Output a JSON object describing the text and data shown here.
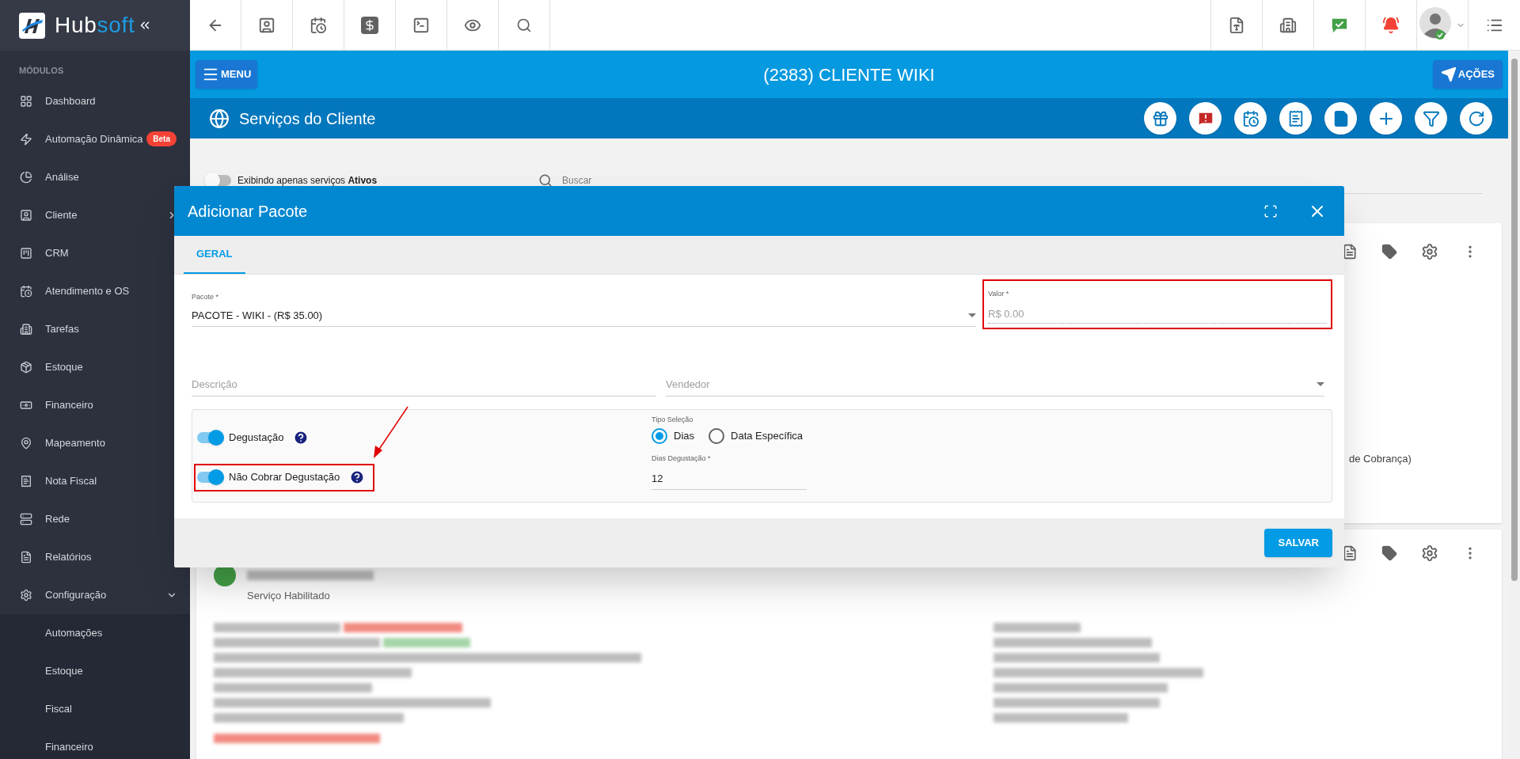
{
  "sidebar": {
    "brand_left": "Hub",
    "brand_right": "soft",
    "section": "MÓDULOS",
    "items": [
      {
        "label": "Dashboard",
        "kind": "link"
      },
      {
        "label": "Automação Dinâmica",
        "kind": "link",
        "badge": "Beta"
      },
      {
        "label": "Análise",
        "kind": "link"
      },
      {
        "label": "Cliente",
        "kind": "group",
        "expanded": false
      },
      {
        "label": "CRM",
        "kind": "link"
      },
      {
        "label": "Atendimento e OS",
        "kind": "link"
      },
      {
        "label": "Tarefas",
        "kind": "link"
      },
      {
        "label": "Estoque",
        "kind": "link"
      },
      {
        "label": "Financeiro",
        "kind": "link"
      },
      {
        "label": "Mapeamento",
        "kind": "link"
      },
      {
        "label": "Nota Fiscal",
        "kind": "link"
      },
      {
        "label": "Rede",
        "kind": "link"
      },
      {
        "label": "Relatórios",
        "kind": "link"
      },
      {
        "label": "Configuração",
        "kind": "group",
        "expanded": true,
        "children": [
          {
            "label": "Automações"
          },
          {
            "label": "Estoque"
          },
          {
            "label": "Fiscal"
          },
          {
            "label": "Financeiro"
          }
        ]
      }
    ]
  },
  "header": {
    "menu_button": "MENU",
    "title": "(2383) CLIENTE WIKI",
    "actions_button": "AÇÕES"
  },
  "page": {
    "title": "Serviços do Cliente",
    "filter_toggle": {
      "label": "Exibindo apenas serviços **Ativos**",
      "on": false
    },
    "search": {
      "placeholder": "Buscar"
    }
  },
  "cards": [
    {
      "tail_text": "de Cobrança)"
    },
    {
      "status": "Serviço Habilitado"
    }
  ],
  "modal": {
    "title": "Adicionar Pacote",
    "tabs": [
      {
        "label": "GERAL",
        "selected": true
      }
    ],
    "pacote": {
      "label": "Pacote *",
      "value": "PACOTE - WIKI - (R$ 35.00)"
    },
    "valor": {
      "label": "Valor *",
      "placeholder": "R$ 0.00",
      "highlighted": true
    },
    "descricao": {
      "placeholder": "Descrição"
    },
    "vendedor": {
      "placeholder": "Vendedor"
    },
    "toggles": [
      {
        "label": "Degustação",
        "on": true,
        "highlighted": false
      },
      {
        "label": "Não Cobrar Degustação",
        "on": true,
        "highlighted": true
      }
    ],
    "tipo": {
      "label": "Tipo Seleção",
      "options": [
        {
          "label": "Dias",
          "selected": true
        },
        {
          "label": "Data Específica",
          "selected": false
        }
      ]
    },
    "dias": {
      "label": "Dias Degustação *",
      "value": "12"
    },
    "save_button": "SALVAR"
  }
}
